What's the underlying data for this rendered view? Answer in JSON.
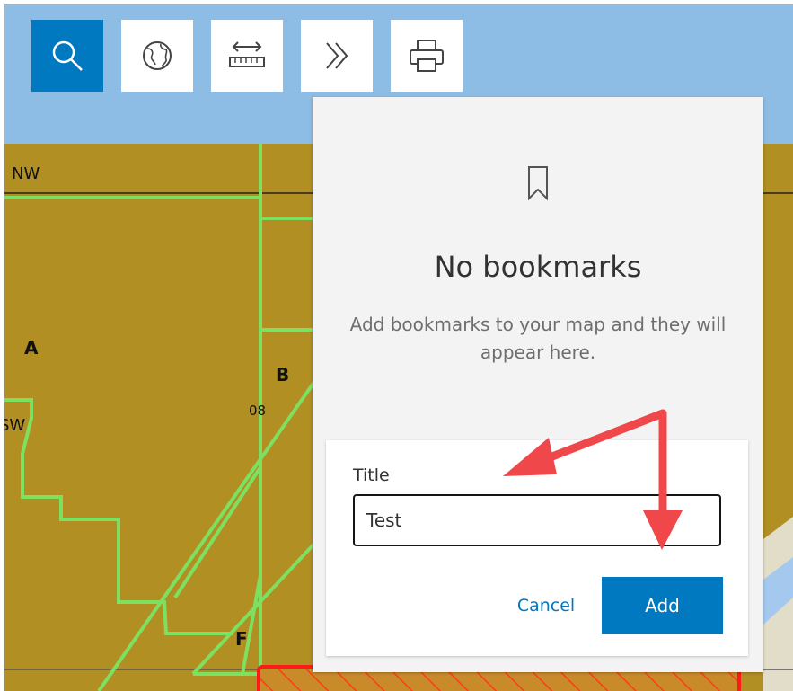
{
  "toolbar": {
    "buttons": [
      {
        "name": "search",
        "icon": "search-icon",
        "active": true
      },
      {
        "name": "basemap",
        "icon": "globe-icon",
        "active": false
      },
      {
        "name": "measure",
        "icon": "ruler-icon",
        "active": false
      },
      {
        "name": "expand",
        "icon": "double-chevron-right-icon",
        "active": false
      },
      {
        "name": "print",
        "icon": "printer-icon",
        "active": false
      }
    ],
    "active_color": "#0079c1"
  },
  "map": {
    "labels": {
      "nw": "NW",
      "sw": "SW",
      "a": "A",
      "b": "B",
      "f": "F",
      "num": "08"
    },
    "colors": {
      "parcel": "#b18f23",
      "boundary": "#7ee061",
      "highlight": "#ff1a1a",
      "sky": "#8dbde4"
    }
  },
  "bookmarks": {
    "icon": "bookmark-icon",
    "empty_title": "No bookmarks",
    "empty_description": "Add bookmarks to your map and they will appear here.",
    "form": {
      "title_label": "Title",
      "title_value": "Test",
      "cancel_label": "Cancel",
      "add_label": "Add"
    }
  },
  "annotation": {
    "arrow_color": "#f0474b"
  }
}
